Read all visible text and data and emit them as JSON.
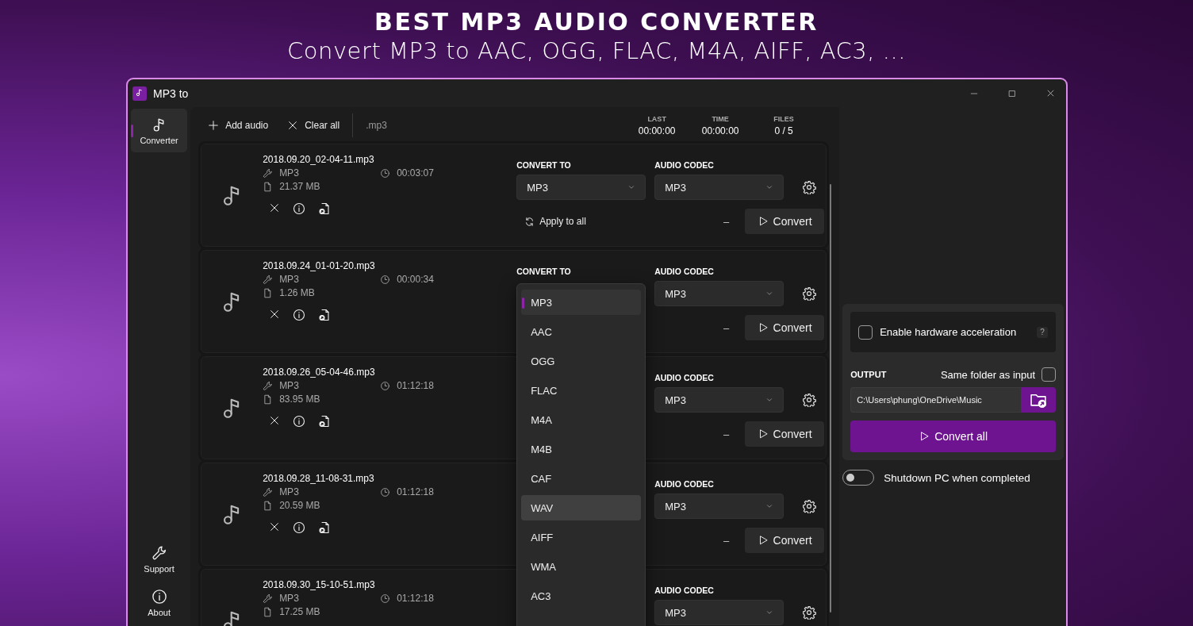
{
  "banner": {
    "title": "BEST MP3 AUDIO CONVERTER",
    "subtitle": "Convert MP3 to AAC, OGG, FLAC, M4A, AIFF, AC3, ..."
  },
  "window": {
    "title": "MP3 to"
  },
  "sidebar": {
    "items": [
      {
        "label": "Converter",
        "kind": "note",
        "selected": true
      }
    ],
    "bottom_items": [
      {
        "label": "Support",
        "kind": "wrench",
        "selected": false
      },
      {
        "label": "About",
        "kind": "info",
        "selected": false
      }
    ]
  },
  "toolbar": {
    "buttons": [
      {
        "label": "Add audio",
        "kind": "add"
      },
      {
        "label": "Clear all",
        "kind": "clear"
      }
    ],
    "filter": ".mp3",
    "stats": [
      {
        "label": "LAST",
        "value": "00:00:00"
      },
      {
        "label": "TIME",
        "value": "00:00:00"
      },
      {
        "label": "FILES",
        "value": "0 / 5"
      }
    ]
  },
  "files": [
    {
      "name": "2018.09.20_02-04-11.mp3",
      "format": "MP3",
      "duration": "00:03:07",
      "size": "21.37 MB",
      "actions": true,
      "convert_to": {
        "label": "CONVERT TO",
        "value": "MP3"
      },
      "audio_codec": {
        "label": "AUDIO CODEC",
        "value": "MP3"
      },
      "apply_to_all": "Apply to all",
      "progress": "–",
      "convert_button": "Convert"
    },
    {
      "name": "2018.09.24_01-01-20.mp3",
      "format": "MP3",
      "duration": "00:00:34",
      "size": "1.26 MB",
      "actions": true,
      "convert_to": {
        "label": "CONVERT TO"
      },
      "audio_codec": {
        "label": "AUDIO CODEC",
        "value": "MP3"
      },
      "progress": "–",
      "convert_button": "Convert"
    },
    {
      "name": "2018.09.26_05-04-46.mp3",
      "format": "MP3",
      "duration": "01:12:18",
      "size": "83.95 MB",
      "actions": true,
      "audio_codec": {
        "label": "AUDIO CODEC",
        "value": "MP3"
      },
      "progress": "–",
      "convert_button": "Convert"
    },
    {
      "name": "2018.09.28_11-08-31.mp3",
      "format": "MP3",
      "duration": "01:12:18",
      "size": "20.59 MB",
      "actions": true,
      "audio_codec": {
        "label": "AUDIO CODEC",
        "value": "MP3"
      },
      "progress": "–",
      "convert_button": "Convert"
    },
    {
      "name": "2018.09.30_15-10-51.mp3",
      "format": "MP3",
      "duration": "01:12:18",
      "size": "17.25 MB",
      "audio_codec": {
        "label": "AUDIO CODEC",
        "value": "MP3"
      }
    }
  ],
  "dropdown": {
    "items": [
      {
        "label": "MP3",
        "selected": true,
        "hovered": false
      },
      {
        "label": "AAC",
        "selected": false,
        "hovered": false
      },
      {
        "label": "OGG",
        "selected": false,
        "hovered": false
      },
      {
        "label": "FLAC",
        "selected": false,
        "hovered": false
      },
      {
        "label": "M4A",
        "selected": false,
        "hovered": false
      },
      {
        "label": "M4B",
        "selected": false,
        "hovered": false
      },
      {
        "label": "CAF",
        "selected": false,
        "hovered": false
      },
      {
        "label": "WAV",
        "selected": false,
        "hovered": true
      },
      {
        "label": "AIFF",
        "selected": false,
        "hovered": false
      },
      {
        "label": "WMA",
        "selected": false,
        "hovered": false
      },
      {
        "label": "AC3",
        "selected": false,
        "hovered": false
      }
    ]
  },
  "panel": {
    "hardware_acceleration": {
      "label": "Enable hardware acceleration",
      "checked": false,
      "help": "?"
    },
    "output": {
      "label": "OUTPUT",
      "same_folder": {
        "label": "Same folder as input",
        "checked": false
      },
      "path": "C:\\Users\\phung\\OneDrive\\Music"
    },
    "convert_all": "Convert all",
    "shutdown": {
      "label": "Shutdown PC when completed",
      "on": false
    }
  }
}
